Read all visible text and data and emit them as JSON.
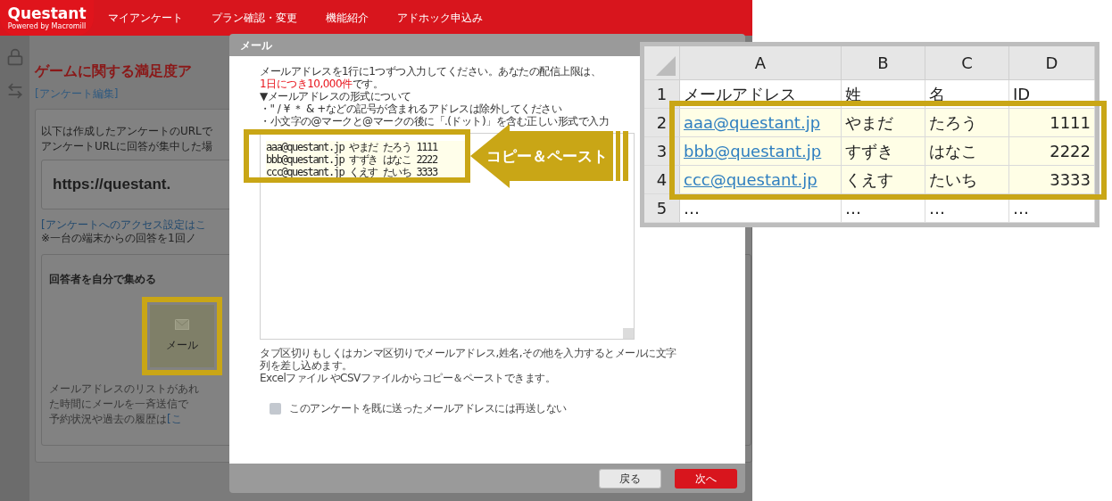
{
  "header": {
    "logo": "Questant",
    "tagline": "Powered by Macromill",
    "nav": [
      "マイアンケート",
      "プラン確認・変更",
      "機能紹介",
      "アドホック申込み"
    ]
  },
  "page": {
    "title": "ゲームに関する満足度ア",
    "edit_link": "[アンケート編集]",
    "intro": [
      "以下は作成したアンケートのURLで",
      "アンケートURLに回答が集中した場"
    ],
    "url": "https://questant.",
    "access_link": "[アンケートへのアクセス設定はこ",
    "note": "※一台の端末からの回答を1回ノ",
    "collect_heading": "回答者を自分で集める",
    "mail_tile": "メール",
    "mail_desc": [
      "メールアドレスのリストがあれ",
      "た時間にメールを一斉送信で",
      "予約状況や過去の履歴は"
    ],
    "history_link": "[こ"
  },
  "modal": {
    "title": "メール",
    "intro": "メールアドレスを1行に1つずつ入力してください。あなたの配信上限は、",
    "limit": "1日につき10,000件",
    "intro_end": "です。",
    "format_heading": "▼メールアドレスの形式について",
    "rules": [
      "・\" / ¥ ＊ & +などの記号が含まれるアドレスは除外してください",
      "・小文字の@マークと@マークの後に「.(ドット)」を含む正しい形式で入力"
    ],
    "textarea_lines": [
      "aaa@questant.jp やまだ たろう 1111",
      "bbb@questant.jp すずき はなこ 2222",
      "ccc@questant.jp くえす たいち 3333"
    ],
    "help": [
      "タブ区切りもしくはカンマ区切りでメールアドレス,姓名,その他を入力するとメールに文字列を差し込めます。",
      "Excelファイル やCSVファイルからコピー＆ペーストできます。"
    ],
    "checkbox": {
      "label": "このアンケートを既に送ったメールアドレスには再送しない",
      "checked": false
    },
    "buttons": [
      {
        "label": "戻る",
        "kind": "secondary"
      },
      {
        "label": "次へ",
        "kind": "primary"
      }
    ]
  },
  "spreadsheet": {
    "columns": [
      "A",
      "B",
      "C",
      "D"
    ],
    "rows": [
      {
        "number": "1",
        "highlighted": false,
        "cells": [
          {
            "text": "メールアドレス",
            "kind": "text"
          },
          {
            "text": "姓",
            "kind": "text"
          },
          {
            "text": "名",
            "kind": "text"
          },
          {
            "text": "ID",
            "kind": "text"
          }
        ]
      },
      {
        "number": "2",
        "highlighted": true,
        "cells": [
          {
            "text": "aaa@questant.jp",
            "kind": "link"
          },
          {
            "text": "やまだ",
            "kind": "text"
          },
          {
            "text": "たろう",
            "kind": "text"
          },
          {
            "text": "1111",
            "kind": "number"
          }
        ]
      },
      {
        "number": "3",
        "highlighted": true,
        "cells": [
          {
            "text": "bbb@questant.jp",
            "kind": "link"
          },
          {
            "text": "すずき",
            "kind": "text"
          },
          {
            "text": "はなこ",
            "kind": "text"
          },
          {
            "text": "2222",
            "kind": "number"
          }
        ]
      },
      {
        "number": "4",
        "highlighted": true,
        "cells": [
          {
            "text": "ccc@questant.jp",
            "kind": "link"
          },
          {
            "text": "くえす",
            "kind": "text"
          },
          {
            "text": "たいち",
            "kind": "text"
          },
          {
            "text": "3333",
            "kind": "number"
          }
        ]
      },
      {
        "number": "5",
        "highlighted": false,
        "cells": [
          {
            "text": "…",
            "kind": "text"
          },
          {
            "text": "…",
            "kind": "text"
          },
          {
            "text": "…",
            "kind": "text"
          },
          {
            "text": "…",
            "kind": "text"
          }
        ]
      }
    ]
  },
  "callout": {
    "label": "コピー＆ペースト"
  }
}
